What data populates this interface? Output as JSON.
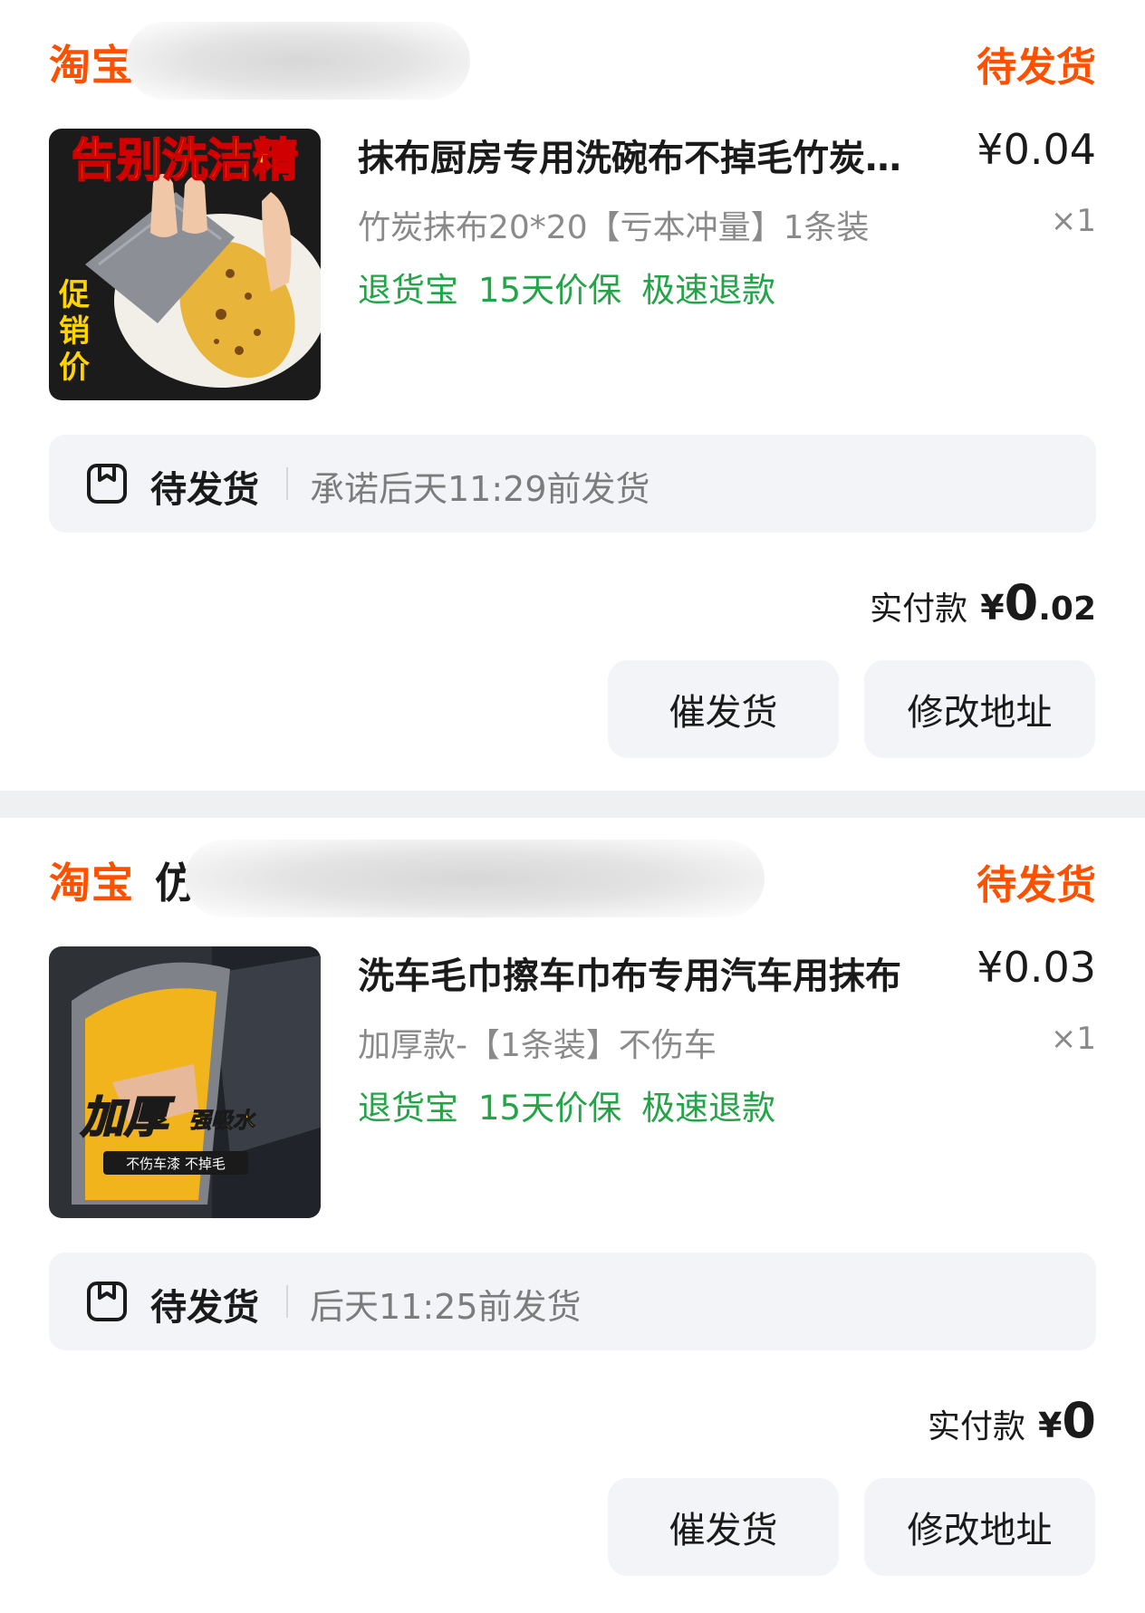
{
  "orders": [
    {
      "store_logo": "淘宝",
      "store_name": "",
      "status": "待发货",
      "product": {
        "image_caption_top": "告别洗洁精",
        "image_caption_side": "促销价",
        "title": "抹布厨房专用洗碗布不掉毛竹炭抹布",
        "price": "¥0.04",
        "sku": "竹炭抹布20*20【亏本冲量】1条装",
        "quantity": "×1",
        "tags": [
          "退货宝",
          "15天价保",
          "极速退款"
        ]
      },
      "shipping": {
        "label": "待发货",
        "desc": "承诺后天11:29前发货",
        "icon": "package-box-icon"
      },
      "paid": {
        "label": "实付款",
        "currency": "¥",
        "integer": "0",
        "decimal": ".02"
      },
      "buttons": {
        "remind": "催发货",
        "address": "修改地址"
      }
    },
    {
      "store_logo": "淘宝",
      "store_name": "仿",
      "status": "待发货",
      "product": {
        "image_caption_big": "加厚",
        "image_caption_small": "强吸水",
        "image_caption_band": "不伤车漆 不掉毛",
        "title": "洗车毛巾擦车巾布专用汽车用抹布",
        "price": "¥0.03",
        "sku": "加厚款-【1条装】不伤车",
        "quantity": "×1",
        "tags": [
          "退货宝",
          "15天价保",
          "极速退款"
        ]
      },
      "shipping": {
        "label": "待发货",
        "desc": "后天11:25前发货",
        "icon": "package-box-icon"
      },
      "paid": {
        "label": "实付款",
        "currency": "¥",
        "integer": "0",
        "decimal": ""
      },
      "buttons": {
        "remind": "催发货",
        "address": "修改地址"
      }
    }
  ],
  "colors": {
    "brand": "#ff5000",
    "service_tag": "#22a447",
    "muted": "#8a8a8a",
    "panel": "#f2f4f7"
  }
}
